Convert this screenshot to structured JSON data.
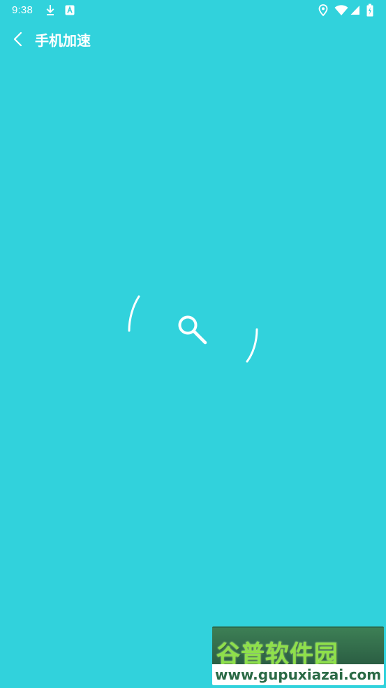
{
  "status_bar": {
    "time": "9:38",
    "left_icons": [
      "download-icon",
      "a-badge-icon"
    ],
    "right_icons": [
      "location-icon",
      "wifi-icon",
      "signal-icon",
      "battery-icon"
    ]
  },
  "header": {
    "back_icon": "chevron-left-icon",
    "title": "手机加速"
  },
  "scanner": {
    "icon": "search-icon",
    "state": "scanning"
  },
  "watermark": {
    "title": "谷普软件园",
    "url": "www.gupuxiazai.com"
  },
  "colors": {
    "background": "#31d2dc",
    "foreground": "#ffffff",
    "watermark_green": "#8ee04a",
    "watermark_dark": "#2e6a4a"
  }
}
